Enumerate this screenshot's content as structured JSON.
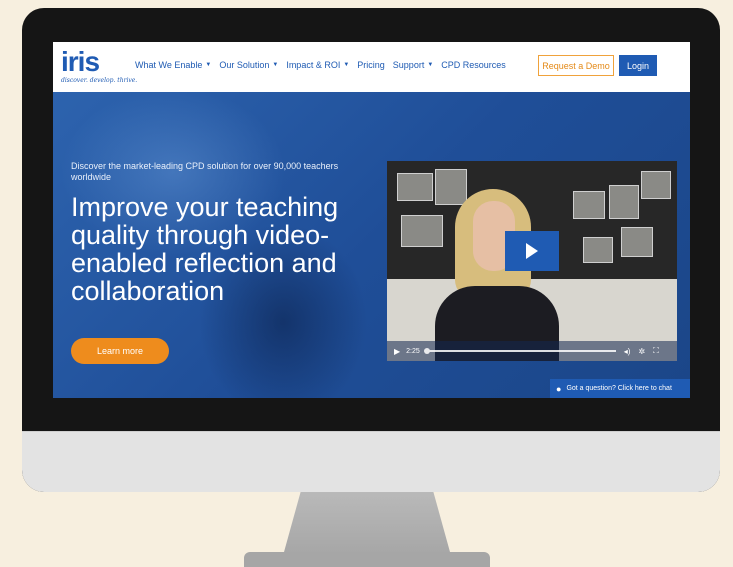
{
  "brand": {
    "logo_text": "iris",
    "tagline": "discover. develop. thrive."
  },
  "nav": {
    "items": [
      {
        "label": "What We Enable",
        "has_caret": true
      },
      {
        "label": "Our Solution",
        "has_caret": true
      },
      {
        "label": "Impact & ROI",
        "has_caret": true
      },
      {
        "label": "Pricing",
        "has_caret": false
      },
      {
        "label": "Support",
        "has_caret": true
      },
      {
        "label": "CPD Resources",
        "has_caret": false
      }
    ],
    "request_demo": "Request a Demo",
    "login": "Login"
  },
  "hero": {
    "kicker": "Discover the market-leading CPD solution for over 90,000 teachers worldwide",
    "title": "Improve your teaching quality through video-enabled reflection and collaboration",
    "cta": "Learn more"
  },
  "video": {
    "time": "2:25",
    "progress": 0.0,
    "play_icon": "play-icon",
    "volume_icon": "volume-icon",
    "settings_icon": "gear-icon",
    "fullscreen_icon": "fullscreen-icon"
  },
  "chat": {
    "label": "Got a question? Click here to chat",
    "icon": "chat-bubble-icon"
  },
  "colors": {
    "brand_blue": "#1f5bb3",
    "accent_orange": "#ee8c1d",
    "page_bg": "#f7efdf"
  }
}
